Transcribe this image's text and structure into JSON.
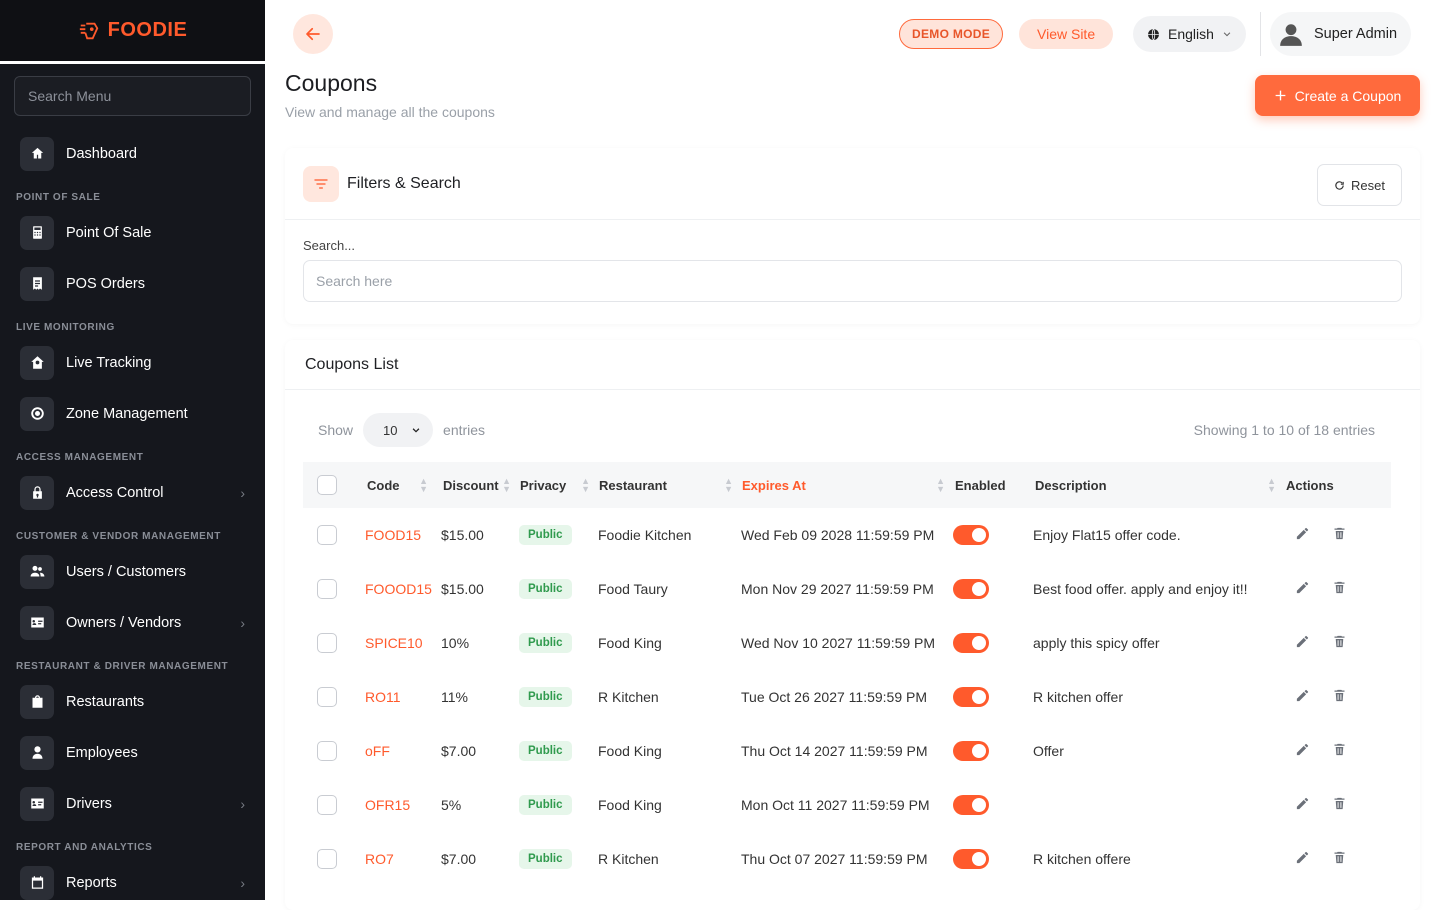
{
  "brand": {
    "name": "FOODIE",
    "accent": "#ff5a2c"
  },
  "sidebar": {
    "search_placeholder": "Search Menu",
    "groups": [
      {
        "title": "",
        "items": [
          {
            "label": "Dashboard",
            "icon": "home-icon"
          }
        ]
      },
      {
        "title": "POINT OF SALE",
        "items": [
          {
            "label": "Point Of Sale",
            "icon": "calculator-icon"
          },
          {
            "label": "POS Orders",
            "icon": "receipt-icon"
          }
        ]
      },
      {
        "title": "LIVE MONITORING",
        "items": [
          {
            "label": "Live Tracking",
            "icon": "tracking-icon"
          },
          {
            "label": "Zone Management",
            "icon": "target-icon"
          }
        ]
      },
      {
        "title": "ACCESS MANAGEMENT",
        "items": [
          {
            "label": "Access Control",
            "icon": "lock-icon",
            "chevron": true
          }
        ]
      },
      {
        "title": "CUSTOMER & VENDOR MANAGEMENT",
        "items": [
          {
            "label": "Users / Customers",
            "icon": "users-icon"
          },
          {
            "label": "Owners / Vendors",
            "icon": "id-card-icon",
            "chevron": true
          }
        ]
      },
      {
        "title": "RESTAURANT & DRIVER MANAGEMENT",
        "items": [
          {
            "label": "Restaurants",
            "icon": "bag-icon"
          },
          {
            "label": "Employees",
            "icon": "person-icon"
          },
          {
            "label": "Drivers",
            "icon": "id-card-icon",
            "chevron": true
          }
        ]
      },
      {
        "title": "REPORT AND ANALYTICS",
        "items": [
          {
            "label": "Reports",
            "icon": "calendar-icon",
            "chevron": true
          }
        ]
      }
    ]
  },
  "topbar": {
    "demo_label": "DEMO MODE",
    "view_site_label": "View Site",
    "language": "English",
    "user_name": "Super Admin"
  },
  "page": {
    "title": "Coupons",
    "subtitle": "View and manage all the coupons",
    "create_label": "Create a Coupon"
  },
  "filters": {
    "title": "Filters & Search",
    "reset_label": "Reset",
    "search_label": "Search...",
    "search_placeholder": "Search here"
  },
  "list": {
    "title": "Coupons List",
    "show_label": "Show",
    "entries_label": "entries",
    "page_size": "10",
    "showing_text": "Showing 1 to 10 of 18 entries",
    "columns": [
      "Code",
      "Discount",
      "Privacy",
      "Restaurant",
      "Expires At",
      "Enabled",
      "Description",
      "Actions"
    ],
    "rows": [
      {
        "code": "FOOD15",
        "discount": "$15.00",
        "privacy": "Public",
        "restaurant": "Foodie Kitchen",
        "expires": "Wed Feb 09 2028 11:59:59 PM",
        "enabled": true,
        "description": "Enjoy Flat15 offer code."
      },
      {
        "code": "FOOOD15",
        "discount": "$15.00",
        "privacy": "Public",
        "restaurant": "Food Taury",
        "expires": "Mon Nov 29 2027 11:59:59 PM",
        "enabled": true,
        "description": "Best food offer. apply and enjoy it!!"
      },
      {
        "code": "SPICE10",
        "discount": "10%",
        "privacy": "Public",
        "restaurant": "Food King",
        "expires": "Wed Nov 10 2027 11:59:59 PM",
        "enabled": true,
        "description": "apply this spicy offer"
      },
      {
        "code": "RO11",
        "discount": "11%",
        "privacy": "Public",
        "restaurant": "R Kitchen",
        "expires": "Tue Oct 26 2027 11:59:59 PM",
        "enabled": true,
        "description": "R kitchen offer"
      },
      {
        "code": "oFF",
        "discount": "$7.00",
        "privacy": "Public",
        "restaurant": "Food King",
        "expires": "Thu Oct 14 2027 11:59:59 PM",
        "enabled": true,
        "description": "Offer"
      },
      {
        "code": "OFR15",
        "discount": "5%",
        "privacy": "Public",
        "restaurant": "Food King",
        "expires": "Mon Oct 11 2027 11:59:59 PM",
        "enabled": true,
        "description": ""
      },
      {
        "code": "RO7",
        "discount": "$7.00",
        "privacy": "Public",
        "restaurant": "R Kitchen",
        "expires": "Thu Oct 07 2027 11:59:59 PM",
        "enabled": true,
        "description": "R kitchen offere"
      }
    ]
  }
}
